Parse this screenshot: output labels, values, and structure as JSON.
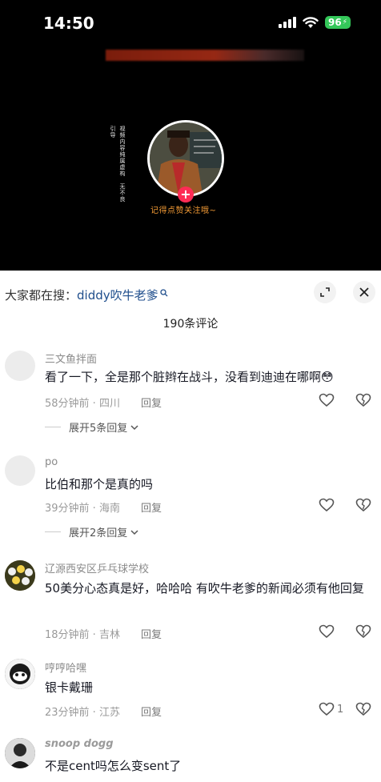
{
  "status": {
    "time": "14:50",
    "battery": "96"
  },
  "video": {
    "side_text": "视频内容纯属虚构　无不良引导",
    "follow_tip": "记得点赞关注哦~",
    "plus": "+"
  },
  "search": {
    "prefix": "大家都在搜：",
    "term": "diddy吹牛老爹"
  },
  "comments_header": {
    "count": "190条评论"
  },
  "comments": [
    {
      "name": "三文鱼拌面",
      "text": "看了一下，全是那个脏辫在战斗，没看到迪迪在哪啊😳",
      "time": "58分钟前 · 四川",
      "reply": "回复",
      "likes": "",
      "expand": "展开5条回复"
    },
    {
      "name": "po",
      "text": "比伯和那个是真的吗",
      "time": "39分钟前 · 海南",
      "reply": "回复",
      "likes": "",
      "expand": "展开2条回复"
    },
    {
      "name": "辽源西安区乒乓球学校",
      "text": "50美分心态真是好，哈哈哈 有吹牛老爹的新闻必须有他回复",
      "time": "18分钟前 · 吉林",
      "reply": "回复",
      "likes": ""
    },
    {
      "name": "哼哼哈嘿",
      "text": "银卡戴珊",
      "time": "23分钟前 · 江苏",
      "reply": "回复",
      "likes": "1"
    },
    {
      "name": "snoop dogg",
      "text": "不是cent吗怎么变sent了",
      "time": "",
      "reply": "",
      "likes": ""
    }
  ],
  "colors": {
    "accent": "#fe2c55",
    "search_term": "#1f4e8c",
    "battery": "#34c759",
    "tip": "#f29a35"
  },
  "icons": [
    "signal-icon",
    "wifi-icon",
    "battery-icon",
    "search-icon",
    "expand-icon",
    "close-icon",
    "heart-icon",
    "broken-heart-icon",
    "chevron-down-icon"
  ]
}
